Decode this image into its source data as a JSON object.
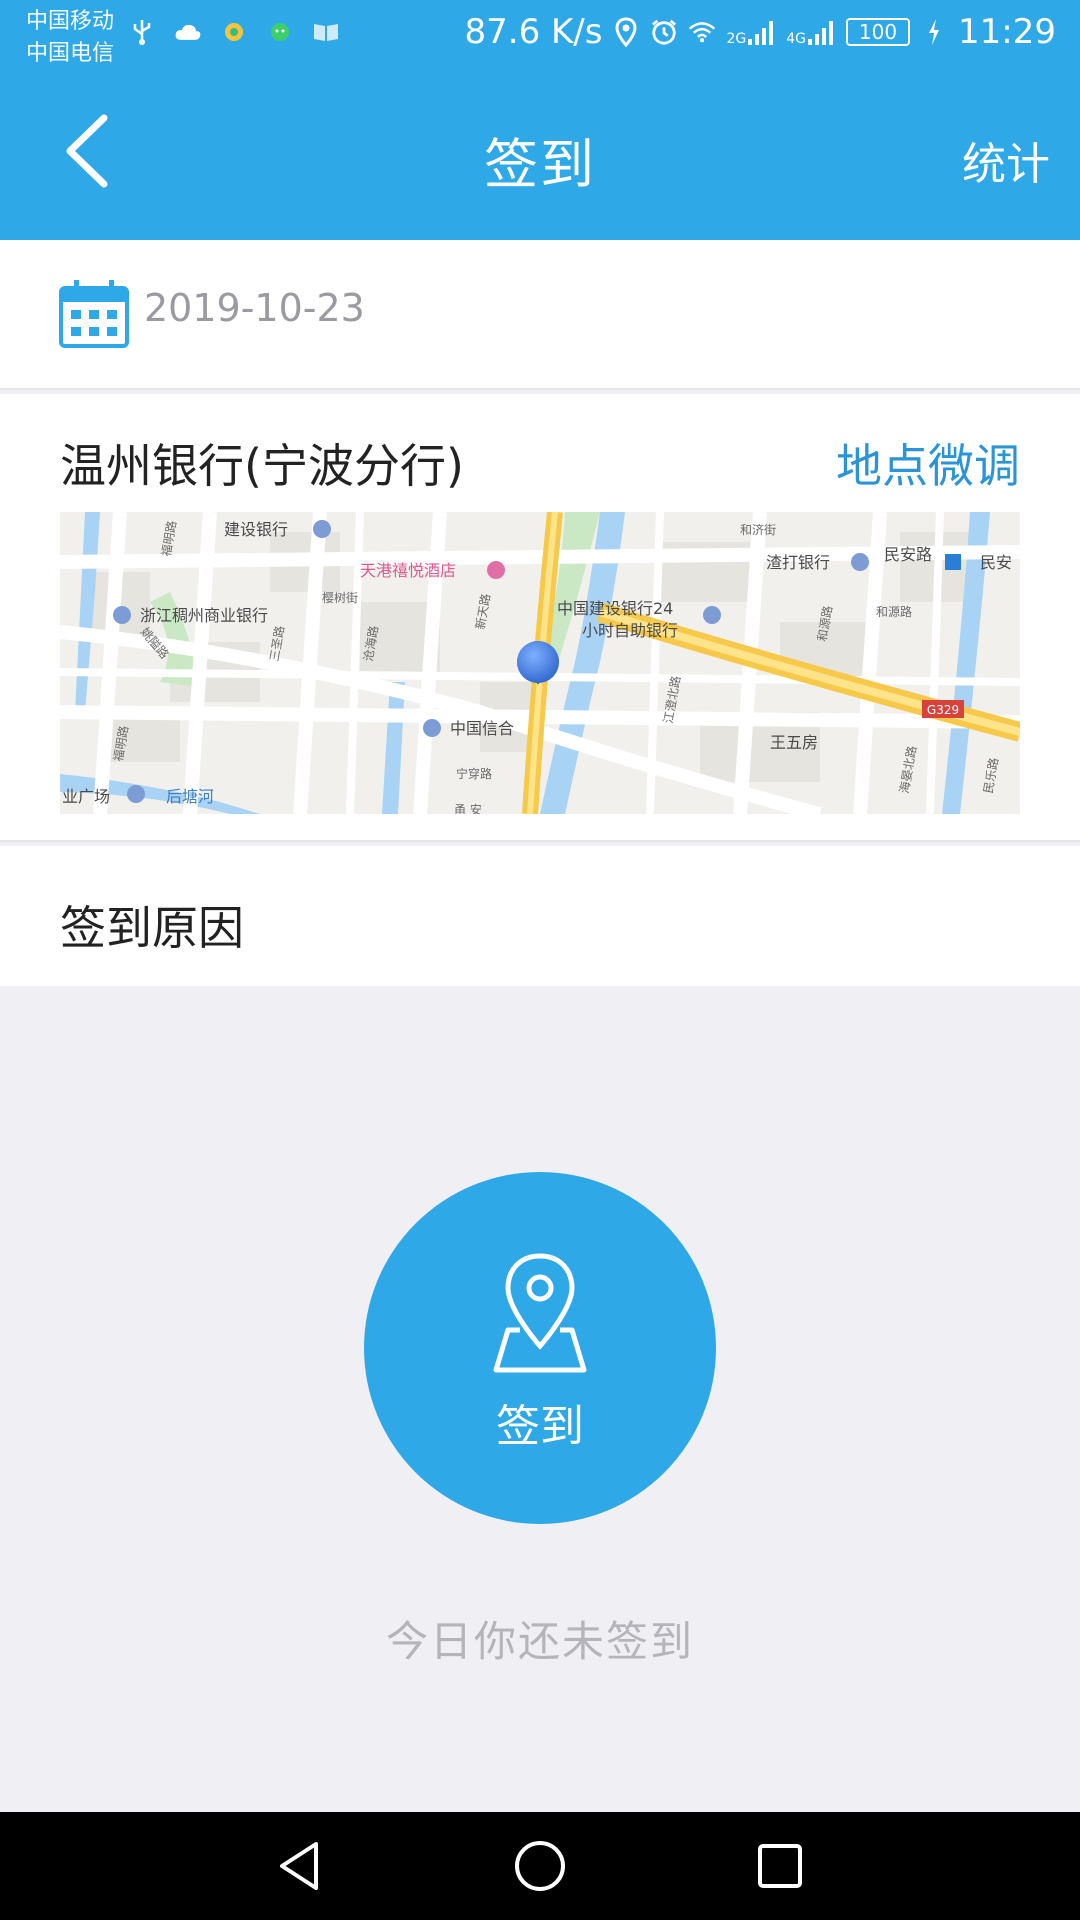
{
  "status_bar": {
    "carrier_1": "中国移动",
    "carrier_2": "中国电信",
    "speed": "87.6 K/s",
    "net_1": "2G",
    "net_2": "4G",
    "battery": "100",
    "time": "11:29",
    "left_icons": [
      "usb-icon",
      "cloud-icon",
      "app-icon",
      "wechat-icon",
      "book-icon"
    ],
    "right_icons": [
      "location-icon",
      "alarm-icon",
      "wifi-icon",
      "signal-icon",
      "signal-icon",
      "battery-icon",
      "charging-icon"
    ]
  },
  "navbar": {
    "title": "签到",
    "right_action": "统计"
  },
  "date_row": {
    "date": "2019-10-23"
  },
  "location": {
    "name": "温州银行(宁波分行)",
    "adjust_label": "地点微调",
    "map_labels": {
      "ccb": "建设银行",
      "hotel": "天港禧悦酒店",
      "zjcz": "浙江稠州商业银行",
      "ccb24_1": "中国建设银行24",
      "ccb24_2": "小时自助银行",
      "citic": "中国信合",
      "chartered": "渣打银行",
      "minan": "民安路",
      "minan2": "民安",
      "wangwufang": "王五房",
      "g329": "G329",
      "hetang": "后塘河",
      "plaza": "业广场",
      "ningchuan": "宁穿路",
      "canghai": "沧海路",
      "jiangcheng": "江澄北路",
      "haiyan": "海晏北路",
      "fuming": "福明路",
      "fuming2": "福明路",
      "heji": "和济街",
      "heyuan": "和源路",
      "xintian": "新天路",
      "yingshu": "樱树街",
      "sanzhen": "三圣路",
      "heyuan2": "和源路",
      "minle": "民乐路",
      "yaotong": "姚隘路",
      "zhou": "甬 安"
    }
  },
  "reason": {
    "label": "签到原因"
  },
  "checkin": {
    "button_label": "签到",
    "status": "今日你还未签到"
  },
  "colors": {
    "primary": "#2ea8e6",
    "link": "#2a94d6",
    "background": "#f0eff4"
  }
}
